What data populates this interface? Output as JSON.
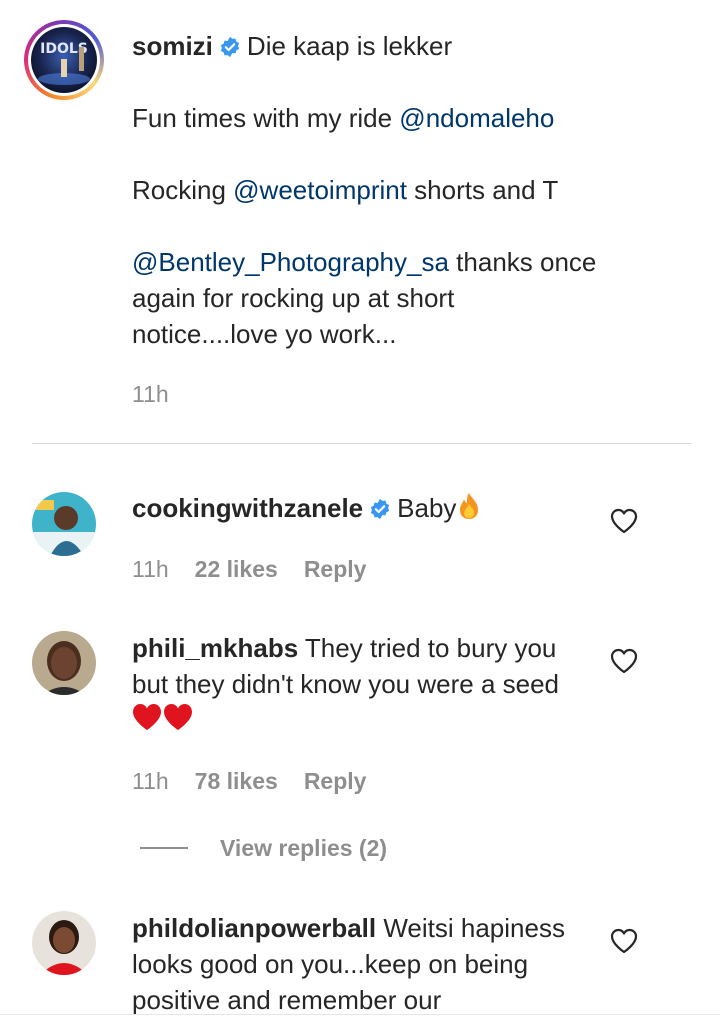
{
  "caption": {
    "username": "somizi",
    "first_line": "Die kaap is lekker",
    "p2_text": "Fun times with my ride ",
    "p2_mention": "@ndomaleho",
    "p3_text1": "Rocking ",
    "p3_mention": "@weetoimprint",
    "p3_text2": " shorts and T",
    "p4_mention": "@Bentley_Photography_sa",
    "p4_text": " thanks once again for rocking up at short notice....love yo work...",
    "time": "11h"
  },
  "comments": [
    {
      "username": "cookingwithzanele",
      "verified": true,
      "text": "Baby",
      "emoji": "fire-emoji",
      "time": "11h",
      "likes": "22 likes",
      "reply": "Reply"
    },
    {
      "username": "phili_mkhabs",
      "verified": false,
      "text": "They tried to bury you but they didn't know you were a seed",
      "emoji": "red-heart-emoji x2",
      "time": "11h",
      "likes": "78 likes",
      "reply": "Reply",
      "view_replies": "View replies (2)"
    },
    {
      "username": "phildolianpowerball",
      "verified": false,
      "text": "Weitsi hapiness looks good on you...keep on being positive and remember our"
    }
  ],
  "colors": {
    "text": "#262626",
    "mention": "#00376b",
    "secondary": "#8e8e8e",
    "verified": "#3897f0"
  },
  "icons": {
    "verified": "verified-badge-icon",
    "like": "heart-outline-icon"
  }
}
